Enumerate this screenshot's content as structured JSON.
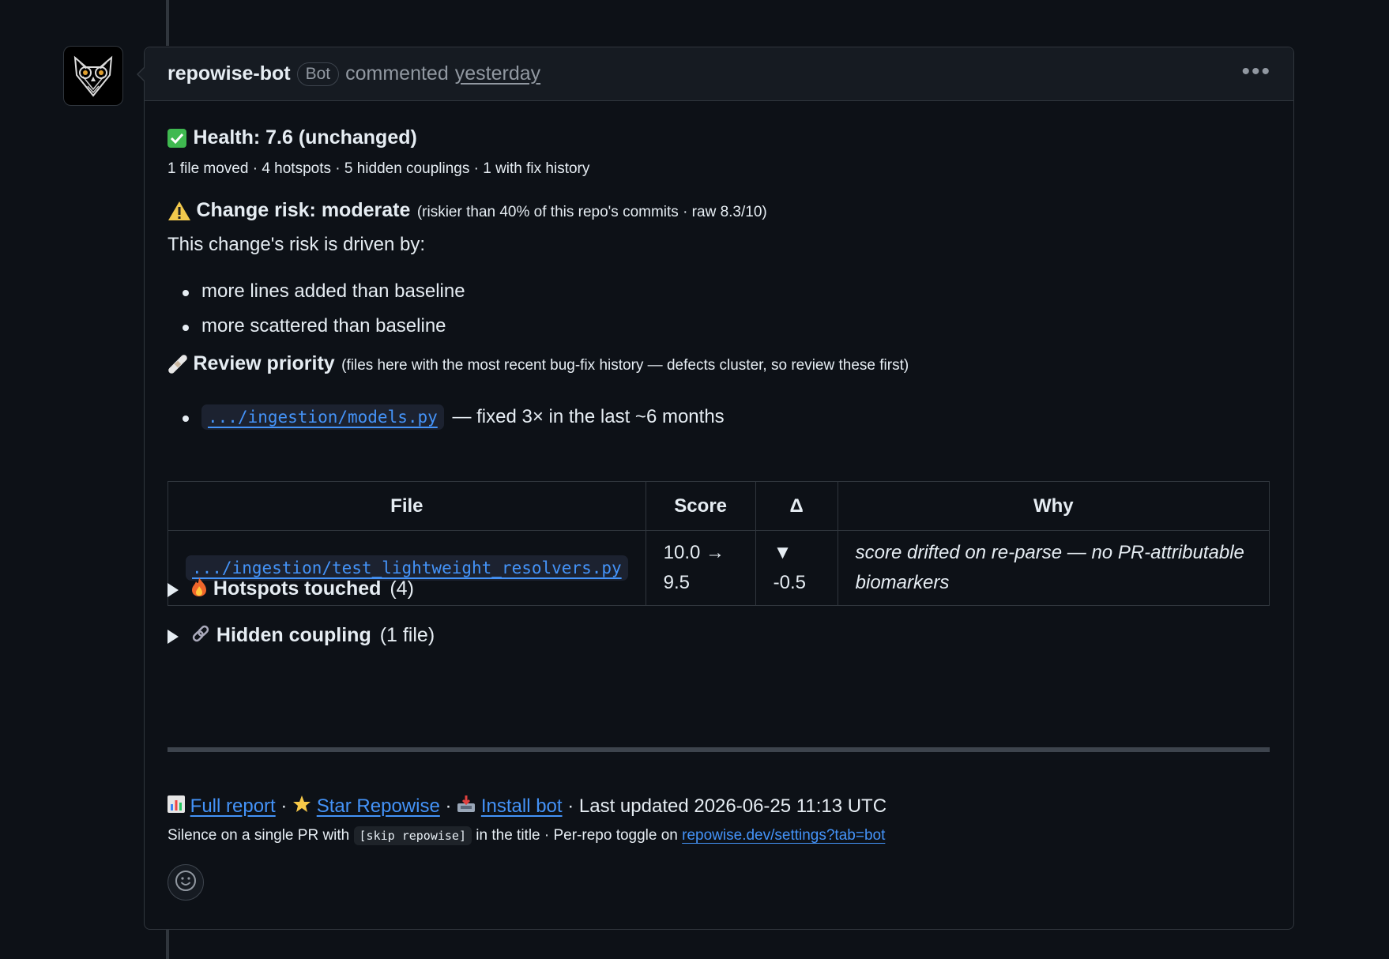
{
  "comment": {
    "author": "repowise-bot",
    "badge": "Bot",
    "action": "commented",
    "when": "yesterday"
  },
  "health": {
    "title": "Health: 7.6 (unchanged)",
    "summary": "1 file moved · 4 hotspots · 5 hidden couplings · 1 with fix history"
  },
  "risk": {
    "title": "Change risk: moderate",
    "note": "(riskier than 40% of this repo's commits · raw 8.3/10)",
    "driven_by": "This change's risk is driven by:",
    "items": [
      "more lines added than baseline",
      "more scattered than baseline"
    ]
  },
  "review": {
    "title": "Review priority",
    "note": "(files here with the most recent bug-fix history — defects cluster, so review these first)",
    "file": ".../ingestion/models.py",
    "file_note": "— fixed 3× in the last ~6 months"
  },
  "table": {
    "headers": [
      "File",
      "Score",
      "Δ",
      "Why"
    ],
    "rows": [
      {
        "file": ".../ingestion/test_lightweight_resolvers.py",
        "score": "10.0 → 9.5",
        "delta": "▼ -0.5",
        "why": "score drifted on re-parse — no PR-attributable biomarkers"
      }
    ]
  },
  "sections": {
    "hotspots_label": "Hotspots touched",
    "hotspots_count": "(4)",
    "coupling_label": "Hidden coupling",
    "coupling_count": "(1 file)"
  },
  "footer": {
    "full_report": "Full report",
    "star": "Star Repowise",
    "install": "Install bot",
    "sep": "·",
    "last_updated": "· Last updated 2026-06-25 11:13 UTC",
    "silence_prefix": "Silence on a single PR with",
    "silence_code": "[skip repowise]",
    "silence_mid": "in the title · Per-repo toggle on",
    "settings_link": "repowise.dev/settings?tab=bot"
  },
  "colors": {
    "background": "#0d1117",
    "link": "#4493f8",
    "border": "#30363d",
    "muted": "#9198a1"
  },
  "icons": [
    "owl-avatar",
    "check-icon",
    "warning-icon",
    "bandage-icon",
    "fire-icon",
    "link-icon",
    "chart-icon",
    "star-icon",
    "inbox-icon",
    "smiley-icon",
    "kebab-icon"
  ]
}
